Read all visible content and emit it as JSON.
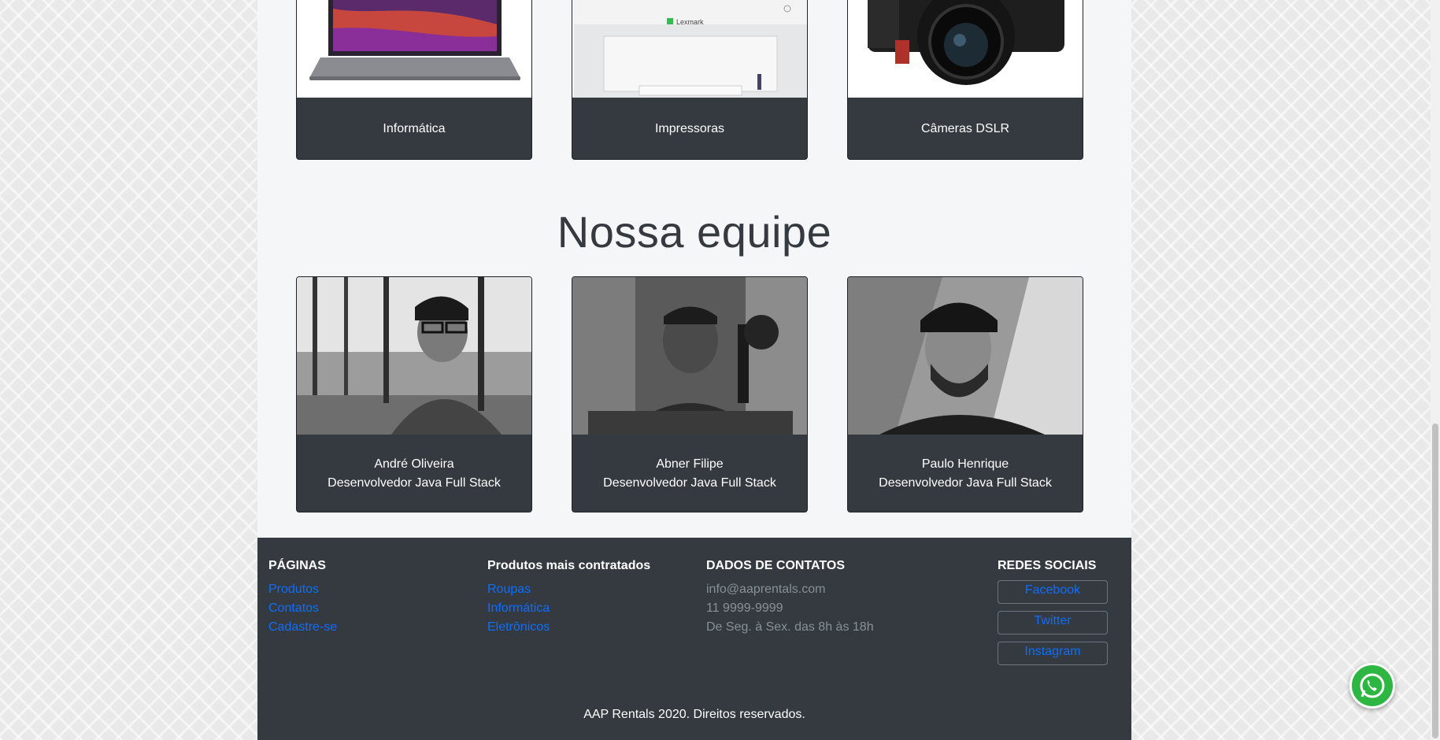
{
  "categories": [
    {
      "label": "Informática",
      "icon": "laptop-image"
    },
    {
      "label": "Impressoras",
      "icon": "printer-image",
      "brand": "Lexmark"
    },
    {
      "label": "Câmeras DSLR",
      "icon": "camera-image"
    }
  ],
  "team": {
    "title": "Nossa equipe",
    "members": [
      {
        "name": "André Oliveira",
        "role": "Desenvolvedor Java Full Stack"
      },
      {
        "name": "Abner Filipe",
        "role": "Desenvolvedor Java Full Stack"
      },
      {
        "name": "Paulo Henrique",
        "role": "Desenvolvedor Java Full Stack"
      }
    ]
  },
  "footer": {
    "pages": {
      "title": "PÁGINAS",
      "links": [
        "Produtos",
        "Contatos",
        "Cadastre-se"
      ]
    },
    "products": {
      "title": "Produtos mais contratados",
      "links": [
        "Roupas",
        "Informática",
        "Eletrônicos"
      ]
    },
    "contacts": {
      "title": "DADOS DE CONTATOS",
      "items": [
        "info@aaprentals.com",
        "11 9999-9999",
        "De Seg. à Sex. das 8h às 18h"
      ]
    },
    "social": {
      "title": "REDES SOCIAIS",
      "buttons": [
        "Facebook",
        "Twitter",
        "Instagram"
      ]
    },
    "copyright": "AAP Rentals 2020. Direitos reservados."
  },
  "whatsapp": {
    "icon": "whatsapp-icon"
  }
}
